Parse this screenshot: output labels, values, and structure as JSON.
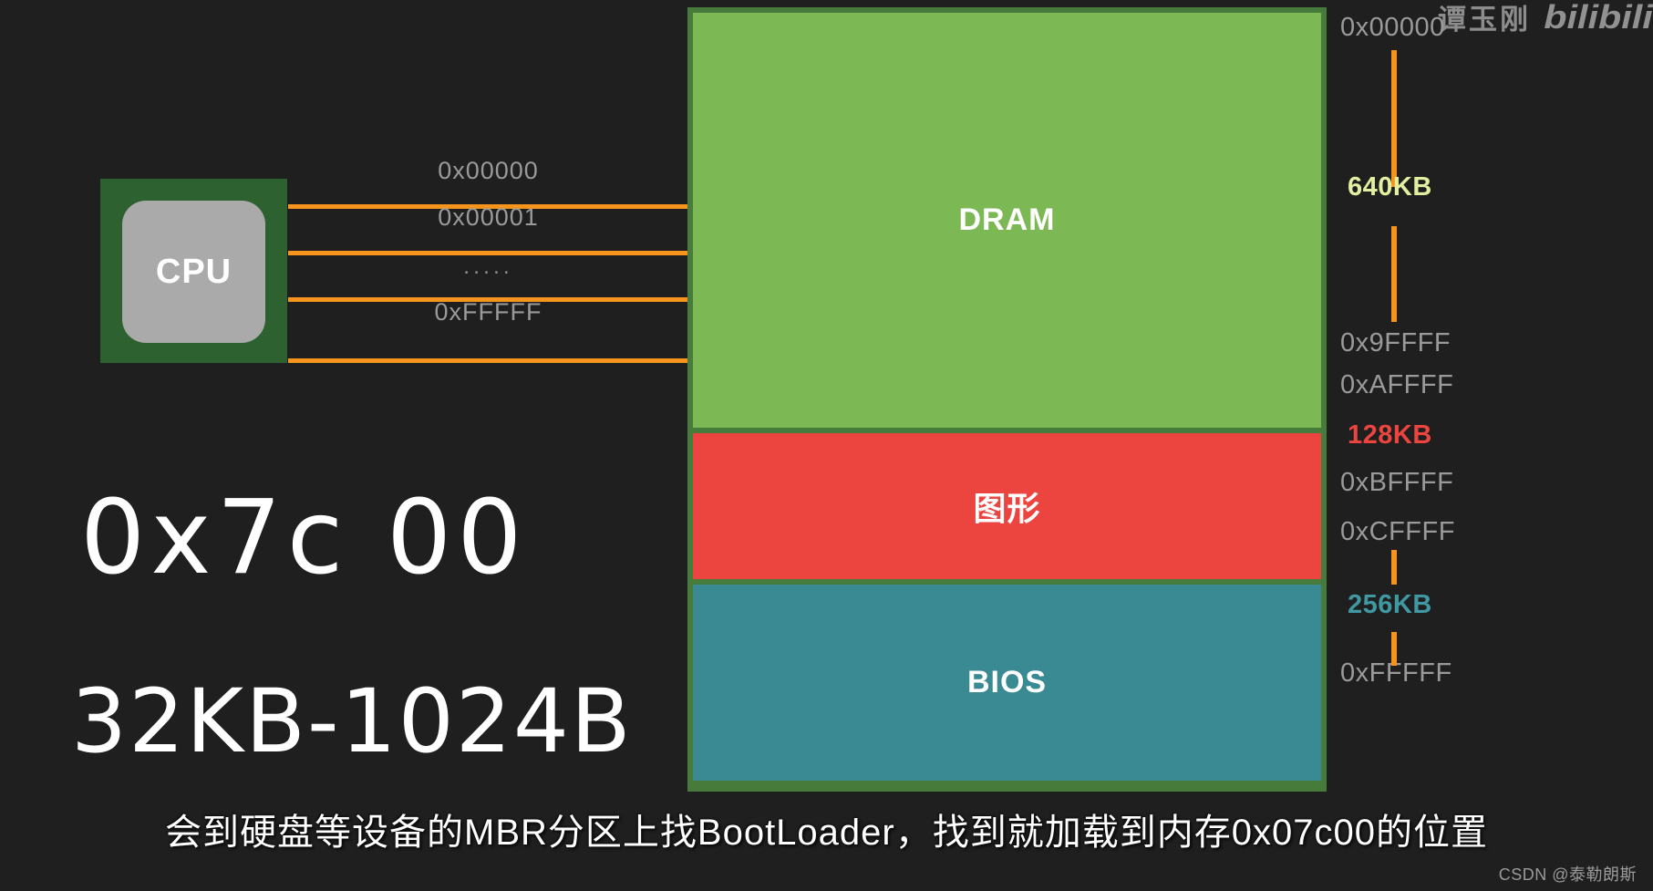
{
  "watermarks": {
    "top_author": "谭玉刚",
    "top_brand": "bilibili",
    "bottom": "CSDN @泰勒朗斯"
  },
  "cpu": {
    "label": "CPU",
    "chip_color": "#2e6130",
    "die_color": "#a9aaa9"
  },
  "bus": {
    "line_color": "#f7941e",
    "labels": [
      "0x00000",
      "0x00001",
      ".....",
      "0xFFFFF"
    ]
  },
  "memory_map": {
    "border_color": "#477b3c",
    "segments": [
      {
        "label": "DRAM",
        "color": "#7cb854"
      },
      {
        "label": "图形",
        "color": "#ec4540"
      },
      {
        "label": "BIOS",
        "color": "#398a93"
      }
    ]
  },
  "scale": {
    "addresses": [
      "0x00000",
      "0x9FFFF",
      "0xAFFFF",
      "0xBFFFF",
      "0xCFFFF",
      "0xFFFFF"
    ],
    "sizes": [
      {
        "text": "640KB",
        "color": "#e3efa0"
      },
      {
        "text": "128KB",
        "color": "#ec4540"
      },
      {
        "text": "256KB",
        "color": "#3f98a2"
      }
    ]
  },
  "notes": {
    "address": "0x7c 00",
    "size": "32KB-1024B"
  },
  "caption": "会到硬盘等设备的MBR分区上找BootLoader，找到就加载到内存0x07c00的位置"
}
